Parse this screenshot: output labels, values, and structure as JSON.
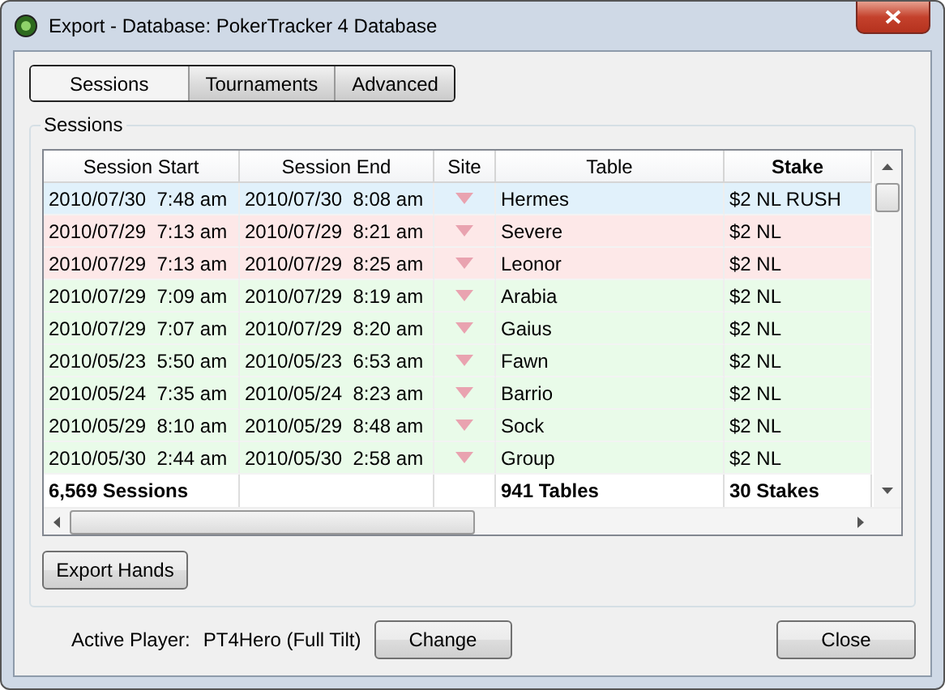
{
  "window": {
    "title": "Export - Database: PokerTracker 4 Database"
  },
  "tabs": [
    {
      "label": "Sessions",
      "selected": true
    },
    {
      "label": "Tournaments",
      "selected": false
    },
    {
      "label": "Advanced",
      "selected": false
    }
  ],
  "group": {
    "title": "Sessions"
  },
  "table": {
    "columns": [
      {
        "label": "Session Start",
        "sorted": false
      },
      {
        "label": "Session End",
        "sorted": false
      },
      {
        "label": "Site",
        "sorted": false
      },
      {
        "label": "Table",
        "sorted": false
      },
      {
        "label": "Stake",
        "sorted": true
      }
    ],
    "rows": [
      {
        "start": "2010/07/30  7:48 am",
        "end": "2010/07/30  8:08 am",
        "table": "Hermes",
        "stake": "$2 NL RUSH",
        "color": "#e1f1fb"
      },
      {
        "start": "2010/07/29  7:13 am",
        "end": "2010/07/29  8:21 am",
        "table": "Severe",
        "stake": "$2 NL",
        "color": "#fde8e8"
      },
      {
        "start": "2010/07/29  7:13 am",
        "end": "2010/07/29  8:25 am",
        "table": "Leonor",
        "stake": "$2 NL",
        "color": "#fde8e8"
      },
      {
        "start": "2010/07/29  7:09 am",
        "end": "2010/07/29  8:19 am",
        "table": "Arabia",
        "stake": "$2 NL",
        "color": "#e9fbe9"
      },
      {
        "start": "2010/07/29  7:07 am",
        "end": "2010/07/29  8:20 am",
        "table": "Gaius",
        "stake": "$2 NL",
        "color": "#e9fbe9"
      },
      {
        "start": "2010/05/23  5:50 am",
        "end": "2010/05/23  6:53 am",
        "table": "Fawn",
        "stake": "$2 NL",
        "color": "#e9fbe9"
      },
      {
        "start": "2010/05/24  7:35 am",
        "end": "2010/05/24  8:23 am",
        "table": "Barrio",
        "stake": "$2 NL",
        "color": "#e9fbe9"
      },
      {
        "start": "2010/05/29  8:10 am",
        "end": "2010/05/29  8:48 am",
        "table": "Sock",
        "stake": "$2 NL",
        "color": "#e9fbe9"
      },
      {
        "start": "2010/05/30  2:44 am",
        "end": "2010/05/30  2:58 am",
        "table": "Group",
        "stake": "$2 NL",
        "color": "#e9fbe9"
      }
    ],
    "totals": {
      "sessions": "6,569 Sessions",
      "tables": "941 Tables",
      "stakes": "30 Stakes"
    }
  },
  "export_button": "Export Hands",
  "footer": {
    "label": "Active Player:",
    "player": "PT4Hero (Full Tilt)",
    "change_button": "Change",
    "close_button": "Close"
  }
}
